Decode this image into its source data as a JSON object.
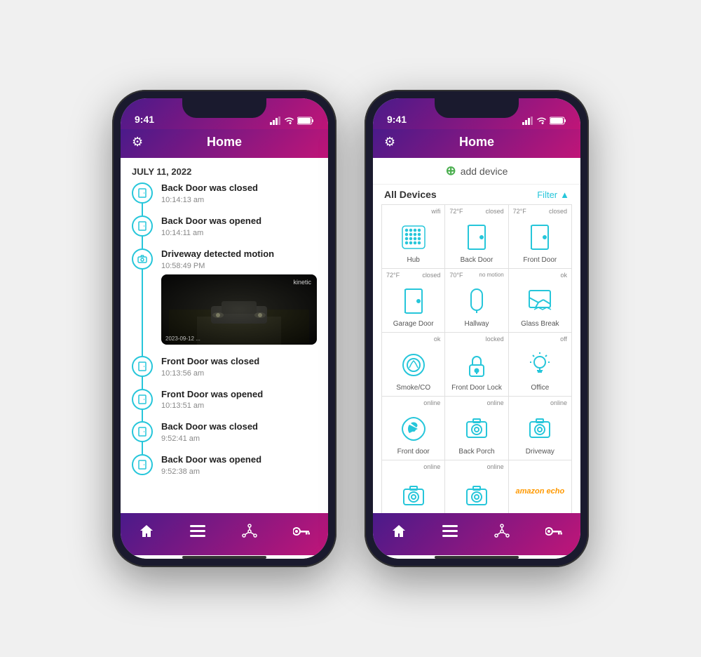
{
  "phone1": {
    "status_time": "9:41",
    "header_title": "Home",
    "settings_icon": "⚙",
    "date_label": "JULY 11, 2022",
    "activities": [
      {
        "icon_type": "door",
        "title": "Back Door was closed",
        "time": "10:14:13 am",
        "has_image": false
      },
      {
        "icon_type": "door",
        "title": "Back Door was opened",
        "time": "10:14:11 am",
        "has_image": false
      },
      {
        "icon_type": "camera",
        "title": "Driveway detected motion",
        "time": "10:58:49 PM",
        "has_image": true,
        "image_label": "kinetic",
        "image_timestamp": "2023-09-12 ..."
      },
      {
        "icon_type": "door",
        "title": "Front Door was closed",
        "time": "10:13:56 am",
        "has_image": false
      },
      {
        "icon_type": "door",
        "title": "Front Door was opened",
        "time": "10:13:51 am",
        "has_image": false
      },
      {
        "icon_type": "door",
        "title": "Back Door was closed",
        "time": "9:52:41 am",
        "has_image": false
      },
      {
        "icon_type": "door",
        "title": "Back Door was opened",
        "time": "9:52:38 am",
        "has_image": false
      }
    ],
    "nav_items": [
      "🏠",
      "≡",
      "✦",
      "🗝"
    ]
  },
  "phone2": {
    "status_time": "9:41",
    "header_title": "Home",
    "settings_icon": "⚙",
    "add_device_label": "add device",
    "all_devices_label": "All Devices",
    "filter_label": "Filter",
    "devices": [
      {
        "name": "Hub",
        "status_right": "wifi",
        "icon_type": "hub",
        "status_left": ""
      },
      {
        "name": "Back Door",
        "status_right": "closed",
        "status_left": "72°F",
        "icon_type": "door"
      },
      {
        "name": "Front Door",
        "status_right": "closed",
        "status_left": "72°F",
        "icon_type": "door"
      },
      {
        "name": "Garage Door",
        "status_right": "closed",
        "status_left": "72°F",
        "icon_type": "door"
      },
      {
        "name": "Hallway",
        "status_right": "no motion",
        "status_left": "70°F",
        "icon_type": "sensor"
      },
      {
        "name": "Glass Break",
        "status_right": "ok",
        "status_left": "",
        "icon_type": "glass_break"
      },
      {
        "name": "Smoke/CO",
        "status_right": "ok",
        "status_left": "",
        "icon_type": "smoke"
      },
      {
        "name": "Front Door Lock",
        "status_right": "locked",
        "status_left": "",
        "icon_type": "lock"
      },
      {
        "name": "Office",
        "status_right": "off",
        "status_left": "",
        "icon_type": "light"
      },
      {
        "name": "Front door",
        "status_right": "online",
        "status_left": "",
        "icon_type": "camera_gear"
      },
      {
        "name": "Back Porch",
        "status_right": "online",
        "status_left": "",
        "icon_type": "camera"
      },
      {
        "name": "Driveway",
        "status_right": "online",
        "status_left": "",
        "icon_type": "camera"
      },
      {
        "name": "",
        "status_right": "online",
        "status_left": "",
        "icon_type": "camera"
      },
      {
        "name": "",
        "status_right": "online",
        "status_left": "",
        "icon_type": "camera"
      },
      {
        "name": "",
        "status_right": "",
        "status_left": "",
        "icon_type": "amazon_echo"
      }
    ],
    "nav_items": [
      "🏠",
      "≡",
      "✦",
      "🗝"
    ]
  }
}
